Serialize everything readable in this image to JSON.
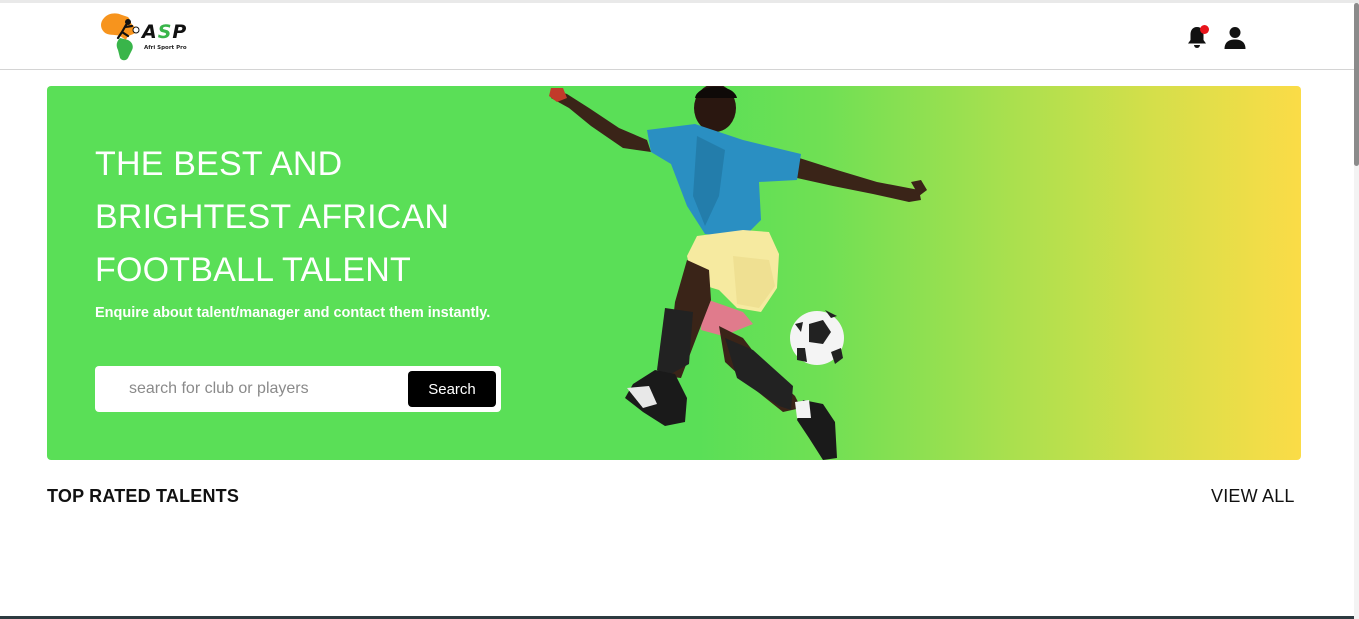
{
  "app": {
    "logo_text_a": "A",
    "logo_text_s": "S",
    "logo_text_p": "P",
    "logo_subtitle": "Afri Sport Pro"
  },
  "header": {
    "notification_icon": "bell-icon",
    "profile_icon": "user-icon",
    "has_unread_notification": true
  },
  "hero": {
    "title_lines": [
      "THE BEST AND",
      "BRIGHTEST AFRICAN",
      "FOOTBALL TALENT"
    ],
    "subtitle": "Enquire about talent/manager and contact them instantly.",
    "search": {
      "placeholder": "search for club or players",
      "value": "",
      "button_label": "Search"
    }
  },
  "section": {
    "title": "TOP RATED TALENTS",
    "view_all_label": "VIEW ALL"
  },
  "colors": {
    "hero_green": "#5adf57",
    "hero_yellow": "#fbdc47",
    "notification_dot": "#e8141b",
    "logo_green": "#39b54a",
    "logo_orange": "#f7941d"
  }
}
